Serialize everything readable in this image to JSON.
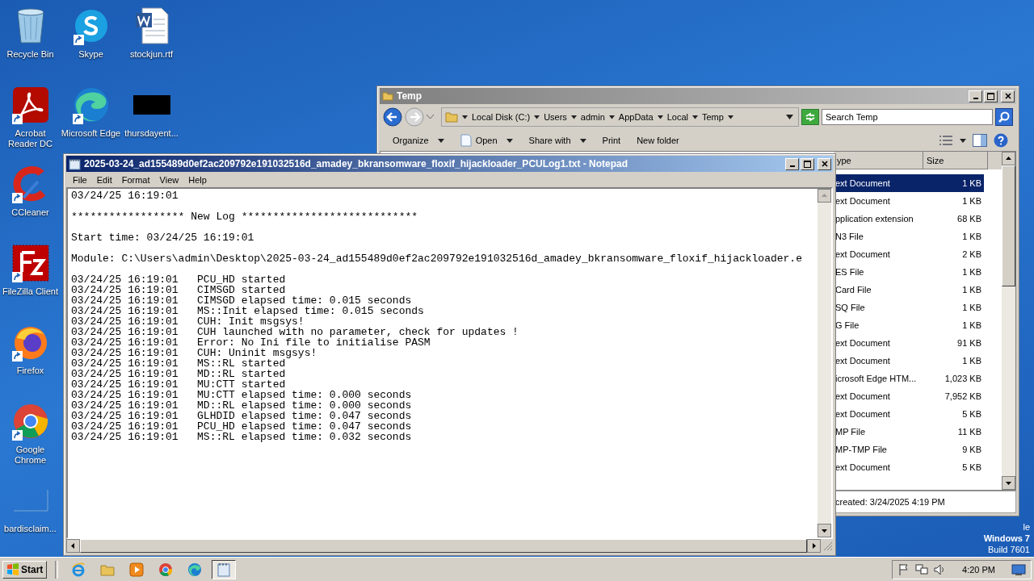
{
  "desktop_icons": [
    [
      {
        "label": "Recycle Bin",
        "kind": "recycle-bin",
        "shortcut": false
      },
      {
        "label": "Acrobat Reader DC",
        "kind": "acrobat",
        "shortcut": true
      },
      {
        "label": "CCleaner",
        "kind": "ccleaner",
        "shortcut": true
      },
      {
        "label": "FileZilla Client",
        "kind": "filezilla",
        "shortcut": true
      },
      {
        "label": "Firefox",
        "kind": "firefox",
        "shortcut": true
      },
      {
        "label": "Google Chrome",
        "kind": "chrome",
        "shortcut": true
      },
      {
        "label": "bardisclaim...",
        "kind": "blank",
        "shortcut": false
      }
    ],
    [
      {
        "label": "Skype",
        "kind": "skype",
        "shortcut": true
      },
      {
        "label": "Microsoft Edge",
        "kind": "edge",
        "shortcut": true
      }
    ],
    [
      {
        "label": "stockjun.rtf",
        "kind": "word-doc",
        "shortcut": false
      },
      {
        "label": "thursdayent...",
        "kind": "blacked",
        "shortcut": false
      }
    ]
  ],
  "explorer": {
    "title": "Temp",
    "active": false,
    "nav_buttons": [
      {
        "kind": "back",
        "disabled": false
      },
      {
        "kind": "forward",
        "disabled": true
      }
    ],
    "breadcrumb": [
      "Local Disk (C:)",
      "Users",
      "admin",
      "AppData",
      "Local",
      "Temp"
    ],
    "search": {
      "placeholder": "Search Temp"
    },
    "toolbar": [
      {
        "label": "Organize",
        "kind": "plain",
        "dropdown": true
      },
      {
        "label": "Open",
        "kind": "with-icon",
        "dropdown": true
      },
      {
        "label": "Share with",
        "kind": "plain",
        "dropdown": true
      },
      {
        "label": "Print",
        "kind": "plain",
        "dropdown": false
      },
      {
        "label": "New folder",
        "kind": "plain",
        "dropdown": false
      }
    ],
    "columns": [
      "ype",
      "Size"
    ],
    "rows": [
      {
        "type": "ext Document",
        "size": "1 KB",
        "selected": true
      },
      {
        "type": "ext Document",
        "size": "1 KB",
        "selected": false
      },
      {
        "type": "pplication extension",
        "size": "68 KB",
        "selected": false
      },
      {
        "type": "N3 File",
        "size": "1 KB",
        "selected": false
      },
      {
        "type": "ext Document",
        "size": "2 KB",
        "selected": false
      },
      {
        "type": "ES File",
        "size": "1 KB",
        "selected": false
      },
      {
        "type": "Card File",
        "size": "1 KB",
        "selected": false
      },
      {
        "type": "SQ File",
        "size": "1 KB",
        "selected": false
      },
      {
        "type": "G File",
        "size": "1 KB",
        "selected": false
      },
      {
        "type": "ext Document",
        "size": "91 KB",
        "selected": false
      },
      {
        "type": "ext Document",
        "size": "1 KB",
        "selected": false
      },
      {
        "type": "icrosoft Edge HTM...",
        "size": "1,023 KB",
        "selected": false
      },
      {
        "type": "ext Document",
        "size": "7,952 KB",
        "selected": false
      },
      {
        "type": "ext Document",
        "size": "5 KB",
        "selected": false
      },
      {
        "type": "MP File",
        "size": "11 KB",
        "selected": false
      },
      {
        "type": "MP-TMP File",
        "size": "9 KB",
        "selected": false
      },
      {
        "type": "ext Document",
        "size": "5 KB",
        "selected": false
      }
    ],
    "details": "created: 3/24/2025 4:19 PM"
  },
  "notepad": {
    "title": "2025-03-24_ad155489d0ef2ac209792e191032516d_amadey_bkransomware_floxif_hijackloader_PCULog1.txt - Notepad",
    "active": true,
    "menu": [
      "File",
      "Edit",
      "Format",
      "View",
      "Help"
    ],
    "blocks": [
      [
        "03/24/25 16:19:01"
      ],
      [
        "****************** New Log ****************************"
      ],
      [
        "Start time: 03/24/25 16:19:01"
      ],
      [
        "Module: C:\\Users\\admin\\Desktop\\2025-03-24_ad155489d0ef2ac209792e191032516d_amadey_bkransomware_floxif_hijackloader.e"
      ],
      [
        "03/24/25 16:19:01   PCU_HD started",
        "03/24/25 16:19:01   CIMSGD started",
        "03/24/25 16:19:01   CIMSGD elapsed time: 0.015 seconds",
        "03/24/25 16:19:01   MS::Init elapsed time: 0.015 seconds",
        "03/24/25 16:19:01   CUH: Init msgsys!",
        "03/24/25 16:19:01   CUH launched with no parameter, check for updates !",
        "03/24/25 16:19:01   Error: No Ini file to initialise PASM",
        "03/24/25 16:19:01   CUH: Uninit msgsys!",
        "03/24/25 16:19:01   MS::RL started",
        "03/24/25 16:19:01   MD::RL started",
        "03/24/25 16:19:01   MU:CTT started",
        "03/24/25 16:19:01   MU:CTT elapsed time: 0.000 seconds",
        "03/24/25 16:19:01   MD::RL elapsed time: 0.000 seconds",
        "03/24/25 16:19:01   GLHDID elapsed time: 0.047 seconds",
        "03/24/25 16:19:01   PCU_HD elapsed time: 0.047 seconds",
        "03/24/25 16:19:01   MS::RL elapsed time: 0.032 seconds"
      ]
    ]
  },
  "os_notice": [
    "le",
    "Windows 7",
    "Build 7601"
  ],
  "taskbar": {
    "start": "Start",
    "apps": [
      {
        "kind": "ie",
        "active": false
      },
      {
        "kind": "folder",
        "active": false
      },
      {
        "kind": "media",
        "active": false
      },
      {
        "kind": "chrome",
        "active": false
      },
      {
        "kind": "edge",
        "active": false
      },
      {
        "kind": "notepad",
        "active": true
      }
    ],
    "clock": "4:20 PM"
  }
}
